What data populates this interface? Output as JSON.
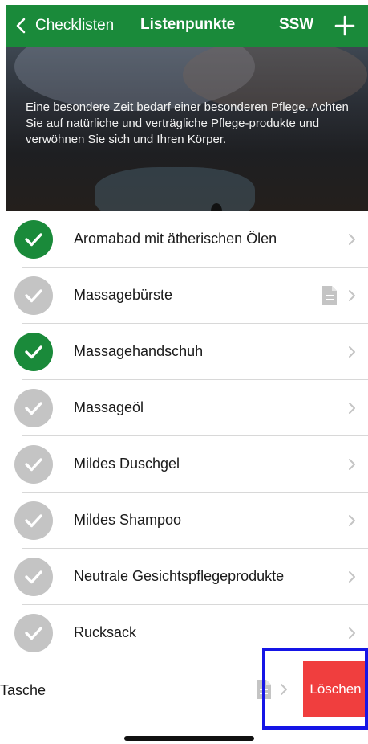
{
  "navbar": {
    "back_label": "Checklisten",
    "title": "Listenpunkte",
    "ssw_label": "SSW",
    "back_icon": "chevron-left-icon",
    "add_icon": "plus-icon"
  },
  "hero": {
    "text": "Eine besondere Zeit bedarf einer besonderen Pflege. Achten Sie auf natürliche und verträgliche Pflege-produkte und verwöhnen Sie sich und Ihren Körper."
  },
  "items": [
    {
      "label": "Aromabad mit ätherischen Ölen",
      "checked": true,
      "has_note": false
    },
    {
      "label": "Massagebürste",
      "checked": false,
      "has_note": true
    },
    {
      "label": "Massagehandschuh",
      "checked": true,
      "has_note": false
    },
    {
      "label": "Massageöl",
      "checked": false,
      "has_note": false
    },
    {
      "label": "Mildes Duschgel",
      "checked": false,
      "has_note": false
    },
    {
      "label": "Mildes Shampoo",
      "checked": false,
      "has_note": false
    },
    {
      "label": "Neutrale Gesichtspflegeprodukte",
      "checked": false,
      "has_note": false
    },
    {
      "label": "Rucksack",
      "checked": false,
      "has_note": false
    }
  ],
  "swiped_item": {
    "label": "Tasche",
    "has_note": true,
    "delete_label": "Löschen"
  },
  "colors": {
    "brand_green": "#1a8a3a",
    "unchecked_gray": "#c4c4c4",
    "delete_red": "#f03e3e",
    "highlight_blue": "#1515e6"
  }
}
